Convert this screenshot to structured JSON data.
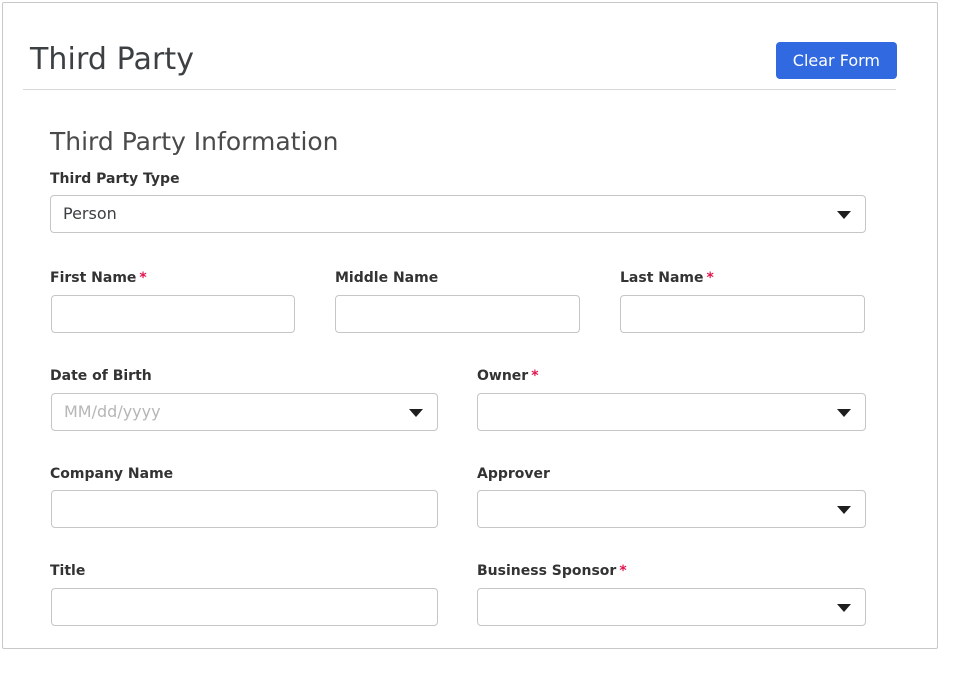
{
  "header": {
    "title": "Third Party",
    "clear_form_label": "Clear Form"
  },
  "section": {
    "heading": "Third Party Information"
  },
  "fields": {
    "third_party_type": {
      "label": "Third Party Type",
      "value": "Person",
      "required": false,
      "caret": "chevron-down-icon"
    },
    "first_name": {
      "label": "First Name",
      "star": "*",
      "value": "",
      "placeholder": ""
    },
    "middle_name": {
      "label": "Middle Name",
      "value": "",
      "placeholder": ""
    },
    "last_name": {
      "label": "Last Name",
      "star": "*",
      "value": "",
      "placeholder": ""
    },
    "date_of_birth": {
      "label": "Date of Birth",
      "value": "",
      "placeholder": "MM/dd/yyyy"
    },
    "owner": {
      "label": "Owner",
      "star": "*",
      "value": ""
    },
    "company_name": {
      "label": "Company Name",
      "value": "",
      "placeholder": ""
    },
    "approver": {
      "label": "Approver",
      "value": ""
    },
    "title": {
      "label": "Title",
      "value": "",
      "placeholder": ""
    },
    "business_sponsor": {
      "label": "Business Sponsor",
      "star": "*",
      "value": ""
    }
  },
  "colors": {
    "accent": "#3069e0",
    "required_star": "#e0144c",
    "input_border": "#c6c6c6",
    "shadow": "#484848"
  }
}
